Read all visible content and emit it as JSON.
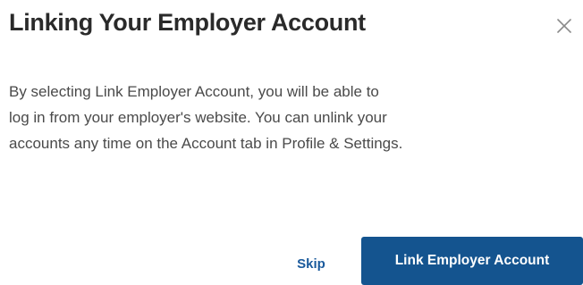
{
  "dialog": {
    "title": "Linking Your Employer Account",
    "close_icon": "close-icon",
    "body_lines": [
      "By selecting Link Employer Account, you will be able to",
      "log in from your employer's website. You can unlink your",
      "accounts any time on the Account tab in Profile & Settings."
    ],
    "skip_label": "Skip",
    "primary_label": "Link Employer Account"
  },
  "colors": {
    "primary": "#14548f",
    "link": "#1a5a9c",
    "title_text": "#2a2a2a",
    "body_text": "#4a4a4a"
  }
}
